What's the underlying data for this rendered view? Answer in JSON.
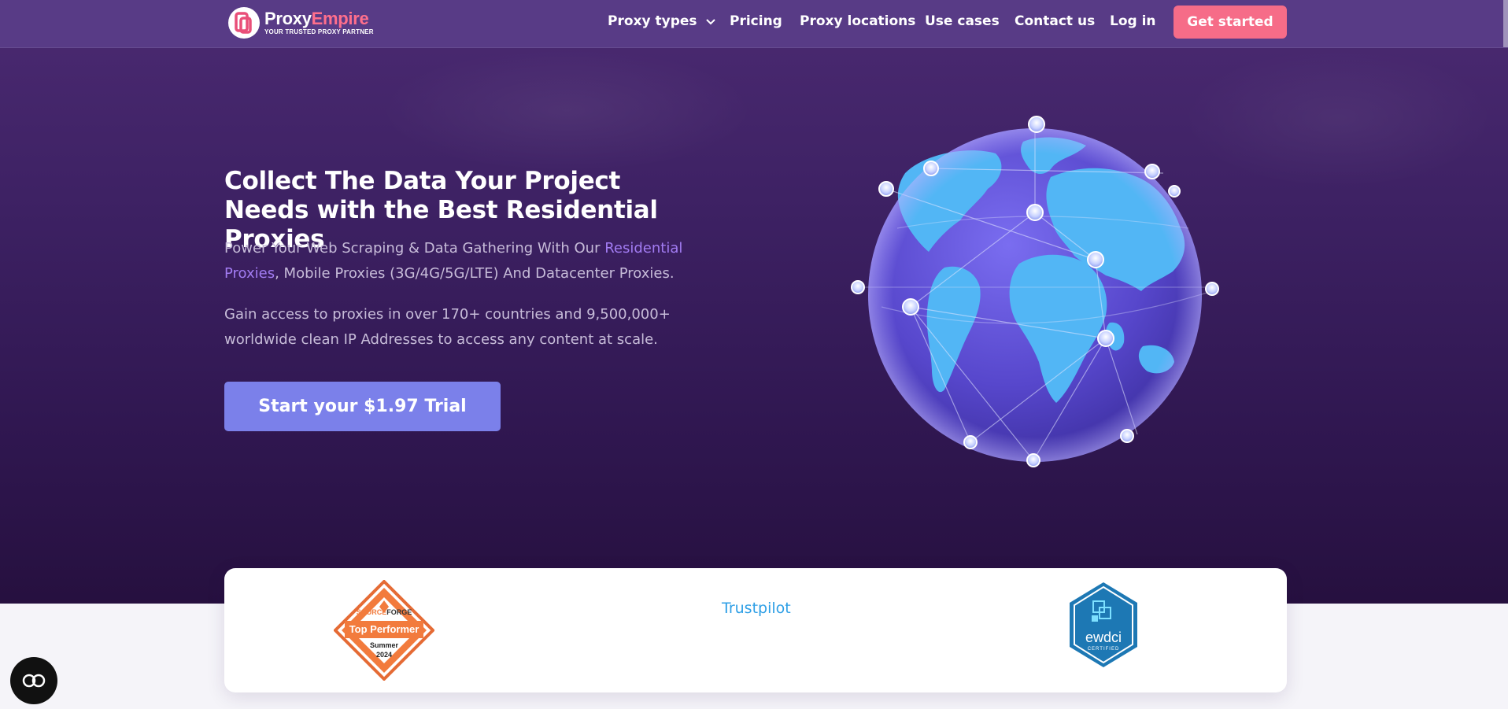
{
  "brand": {
    "name_main": "Proxy",
    "name_accent": "Empire",
    "tagline": "YOUR TRUSTED PROXY PARTNER"
  },
  "nav": {
    "items": [
      {
        "label": "Proxy types",
        "has_dropdown": true
      },
      {
        "label": "Pricing"
      },
      {
        "label": "Proxy locations"
      },
      {
        "label": "Use cases"
      },
      {
        "label": "Contact us"
      },
      {
        "label": "Log in"
      }
    ],
    "cta": "Get started"
  },
  "hero": {
    "headline": "Collect The Data Your Project Needs with the Best Residential Proxies",
    "sub_prefix": "Power Your Web Scraping & Data Gathering With Our ",
    "sub_link": "Residential Proxies",
    "sub_suffix": ", Mobile Proxies (3G/4G/5G/LTE) And Datacenter Proxies.",
    "sub2": "Gain access to proxies in over 170+ countries and 9,500,000+ worldwide clean IP Addresses to access any content at scale.",
    "cta": "Start your $1.97 Trial"
  },
  "badges": {
    "sourceforge": {
      "brand_a": "SOURCE",
      "brand_b": "FORGE",
      "title": "Top Performer",
      "season": "Summer",
      "year": "2024"
    },
    "trustpilot": "Trustpilot",
    "ewdci": {
      "name": "ewdci",
      "sub": "CERTIFIED"
    }
  },
  "icons": {
    "chat": "chat-icon",
    "dropdown": "chevron-down-icon"
  },
  "colors": {
    "nav_bg": "#583b86",
    "hero_bg_top": "#4b2a72",
    "hero_bg_bottom": "#26103f",
    "cta_pink": "#f66c88",
    "trial_btn": "#7b80ea",
    "link_purple": "#a27cf2",
    "globe_land": "#4fb3f4",
    "globe_ocean": "#5a4fcf"
  }
}
